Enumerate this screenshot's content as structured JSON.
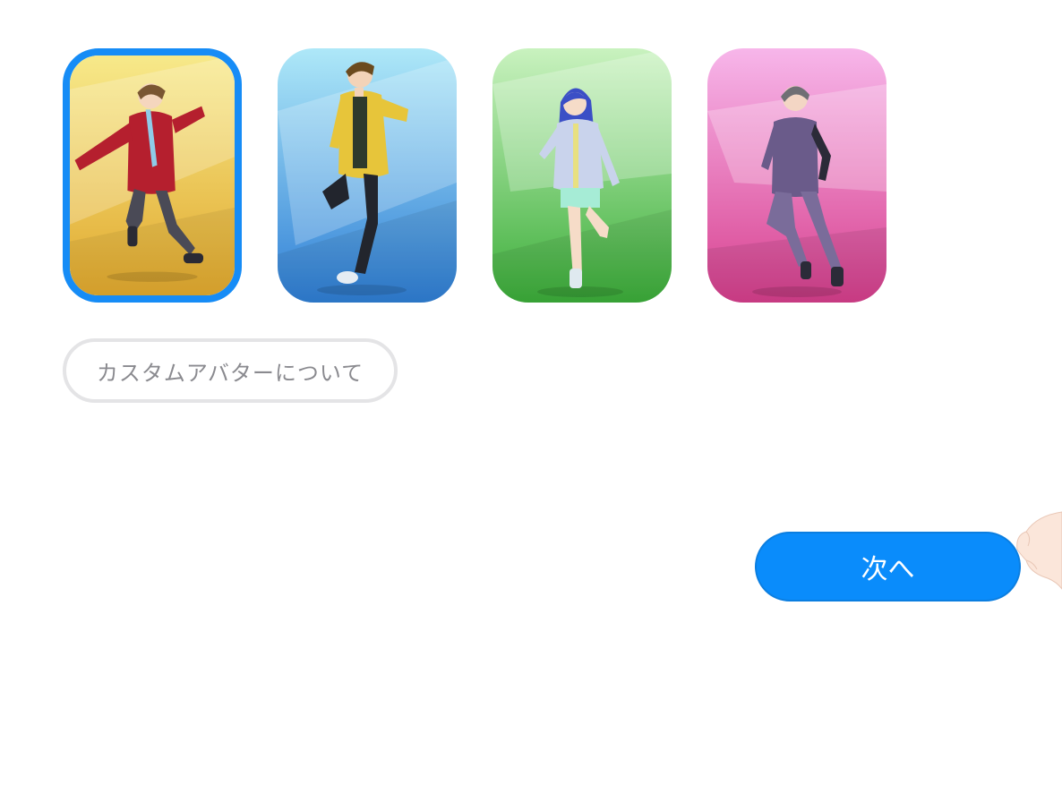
{
  "avatars": [
    {
      "name": "avatar-yellow",
      "selected": true,
      "bg_top": "#f7e98a",
      "bg_bottom": "#e1a92e",
      "outfit": "#b51f2e",
      "accent": "#8fcbe8",
      "hair": "#7a5632",
      "pants": "#4a4a56"
    },
    {
      "name": "avatar-blue",
      "selected": false,
      "bg_top": "#aee8f8",
      "bg_bottom": "#2f7fd6",
      "outfit": "#e7c53a",
      "accent": "#8ec8e4",
      "hair": "#6b4a1e",
      "pants": "#22252d"
    },
    {
      "name": "avatar-green",
      "selected": false,
      "bg_top": "#c9f2bf",
      "bg_bottom": "#3cae3a",
      "outfit": "#c9d3ec",
      "accent": "#e8e080",
      "hair": "#3b4fc6",
      "pants": "#a6ecd6"
    },
    {
      "name": "avatar-pink",
      "selected": false,
      "bg_top": "#f7b6ea",
      "bg_bottom": "#d8408e",
      "outfit": "#6a5b8a",
      "accent": "#2b2b38",
      "hair": "#6f6f74",
      "pants": "#7a6c9a"
    }
  ],
  "about_button": {
    "label": "カスタムアバターについて"
  },
  "next_button": {
    "label": "次へ"
  },
  "colors": {
    "selection_border": "#168cf6",
    "primary_button": "#0a8cfb",
    "secondary_border": "#e4e4e6",
    "secondary_text": "#8a8a8f"
  }
}
